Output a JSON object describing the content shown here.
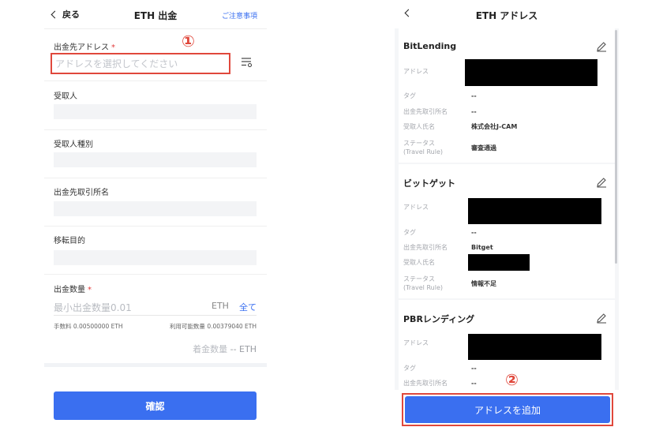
{
  "left": {
    "header": {
      "back_label": "戻る",
      "title": "ETH 出金",
      "notice_label": "ご注意事項"
    },
    "address": {
      "label": "出金先アドレス",
      "required": "*",
      "placeholder": "アドレスを選択してください"
    },
    "fields": [
      {
        "label": "受取人"
      },
      {
        "label": "受取人種別"
      },
      {
        "label": "出金先取引所名"
      },
      {
        "label": "移転目的"
      }
    ],
    "amount": {
      "label": "出金数量",
      "required": "*",
      "placeholder": "最小出金数量0.01",
      "unit": "ETH",
      "all_label": "全て",
      "fee": "手数料 0.00500000 ETH",
      "available": "利用可能数量 0.00379040 ETH",
      "receive_label": "着金数量",
      "receive_value": "-- ETH"
    },
    "confirm_label": "確認",
    "marker": "①"
  },
  "right": {
    "header": {
      "title": "ETH アドレス"
    },
    "row_labels": {
      "address": "アドレス",
      "tag": "タグ",
      "exchange": "出金先取引所名",
      "recipient": "受取人氏名",
      "status_line1": "ステータス",
      "status_line2": "(Travel Rule)"
    },
    "cards": [
      {
        "name": "BitLending",
        "tag": "--",
        "exchange": "--",
        "recipient": "株式会社J-CAM",
        "status": "審査通過"
      },
      {
        "name": "ビットゲット",
        "tag": "--",
        "exchange": "Bitget",
        "recipient": "",
        "status": "情報不足"
      },
      {
        "name": "PBRレンディング",
        "tag": "--",
        "exchange": "--"
      }
    ],
    "add_label": "アドレスを追加",
    "marker": "②"
  },
  "colors": {
    "accent": "#3a6ff0",
    "highlight": "#e0483c",
    "placeholder": "#c3c6cc"
  },
  "icons": [
    "chevron-left-icon",
    "filter-list-icon",
    "edit-pencil-icon"
  ]
}
